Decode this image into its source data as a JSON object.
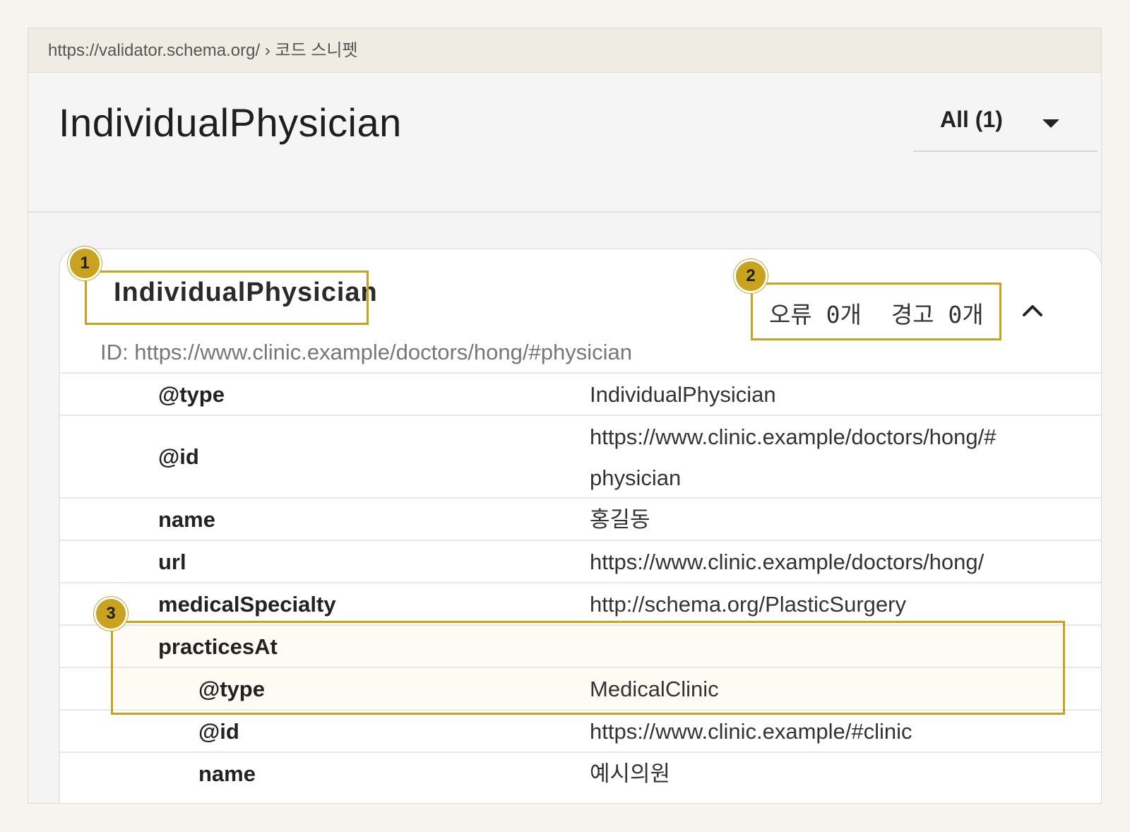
{
  "breadcrumb": {
    "url": "https://validator.schema.org/",
    "separator": "›",
    "section": "코드 스니펫"
  },
  "page": {
    "title": "IndividualPhysician"
  },
  "filter": {
    "label": "All (1)"
  },
  "card": {
    "type": "IndividualPhysician",
    "id": "ID: https://www.clinic.example/doctors/hong/#physician",
    "errors": "오류 0개",
    "warnings": "경고 0개"
  },
  "rows": [
    {
      "key": "@type",
      "value": "IndividualPhysician"
    },
    {
      "key": "@id",
      "value_line1": "https://www.clinic.example/doctors/hong/#",
      "value_line2": "physician"
    },
    {
      "key": "name",
      "value": "홍길동"
    },
    {
      "key": "url",
      "value": "https://www.clinic.example/doctors/hong/"
    },
    {
      "key": "medicalSpecialty",
      "value": "http://schema.org/PlasticSurgery"
    },
    {
      "key": "practicesAt",
      "value": ""
    },
    {
      "key": "@type",
      "value": "MedicalClinic"
    },
    {
      "key": "@id",
      "value": "https://www.clinic.example/#clinic"
    },
    {
      "key": "name",
      "value": "예시의원"
    }
  ],
  "annotations": [
    "1",
    "2",
    "3"
  ],
  "colors": {
    "highlight": "#c9a21f"
  },
  "icons": {
    "filter": "caret-down-icon",
    "collapse": "chevron-up-icon"
  }
}
